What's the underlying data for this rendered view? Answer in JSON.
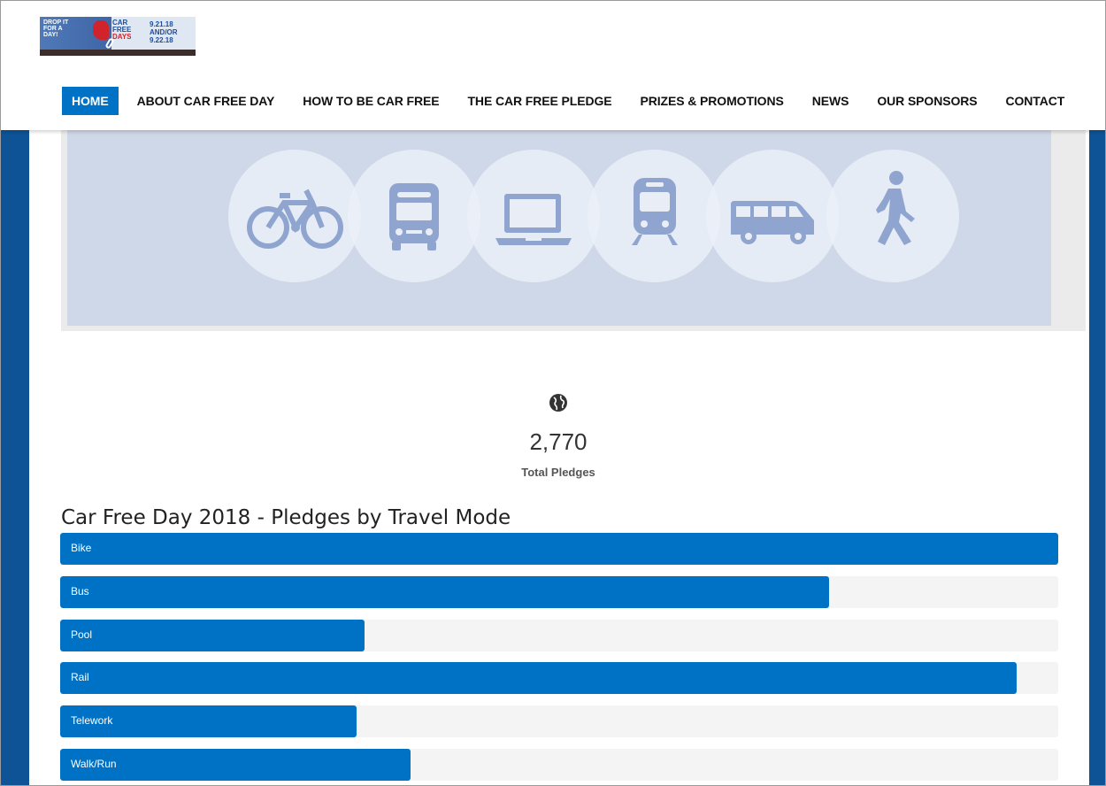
{
  "logo": {
    "left_text": "DROP IT\nFOR A\nDAY!",
    "mid_text_top": "CAR\nFREE",
    "mid_text_red": "DAYS",
    "dates": "9.21.18\nAND/OR\n9.22.18"
  },
  "nav": {
    "items": [
      {
        "label": "HOME",
        "active": true
      },
      {
        "label": "ABOUT CAR FREE DAY",
        "active": false
      },
      {
        "label": "HOW TO BE CAR FREE",
        "active": false
      },
      {
        "label": "THE CAR FREE PLEDGE",
        "active": false
      },
      {
        "label": "PRIZES & PROMOTIONS",
        "active": false
      },
      {
        "label": "NEWS",
        "active": false
      },
      {
        "label": "OUR SPONSORS",
        "active": false
      },
      {
        "label": "CONTACT",
        "active": false
      }
    ]
  },
  "banner": {
    "icons": [
      "bicycle-icon",
      "bus-icon",
      "laptop-icon",
      "train-icon",
      "van-icon",
      "walking-person-icon"
    ]
  },
  "stats": {
    "icon": "globe-icon",
    "total": "2,770",
    "label": "Total Pledges"
  },
  "colors": {
    "accent": "#0072c6",
    "side_bars": "#0d5396",
    "banner_bg": "#cfd8e8",
    "icon_color": "#8fa5cf",
    "track": "#f4f4f4"
  },
  "chart_data": {
    "type": "bar",
    "orientation": "horizontal",
    "title": "Car Free Day 2018 - Pledges by Travel Mode",
    "categories": [
      "Bike",
      "Bus",
      "Pool",
      "Rail",
      "Telework",
      "Walk/Run"
    ],
    "values": [
      1.0,
      0.77,
      0.305,
      0.958,
      0.297,
      0.351
    ],
    "value_note": "fraction of the longest bar",
    "xlim": [
      0,
      1
    ]
  }
}
